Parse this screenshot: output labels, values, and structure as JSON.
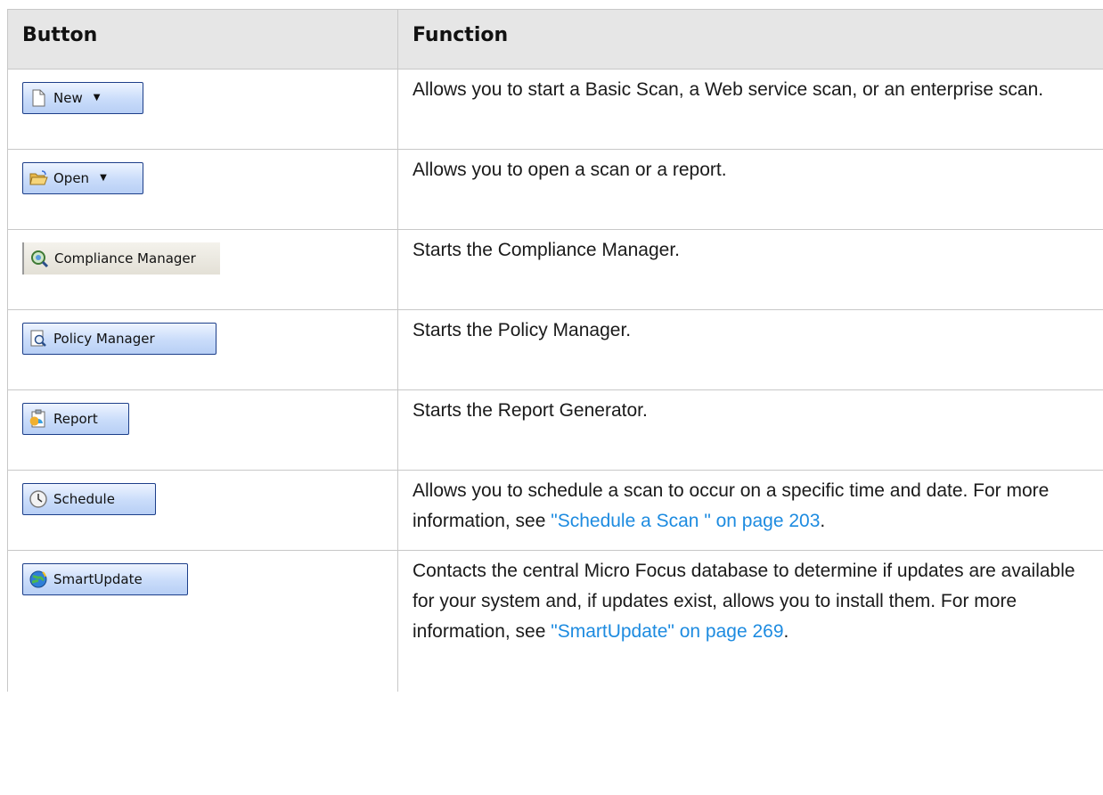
{
  "header": {
    "button_col": "Button",
    "function_col": "Function"
  },
  "rows": [
    {
      "button_label": "New",
      "has_dropdown": true,
      "icon": "document-icon",
      "function_text": "Allows you to start a Basic Scan, a Web service scan, or an enterprise scan."
    },
    {
      "button_label": "Open",
      "has_dropdown": true,
      "icon": "folder-open-icon",
      "function_text": "Allows you to open a scan or a report."
    },
    {
      "button_label": "Compliance Manager",
      "has_dropdown": false,
      "icon": "compliance-magnifier-icon",
      "function_text": "Starts the Compliance Manager."
    },
    {
      "button_label": "Policy Manager",
      "has_dropdown": false,
      "icon": "policy-magnifier-icon",
      "function_text": "Starts the Policy Manager."
    },
    {
      "button_label": "Report",
      "has_dropdown": false,
      "icon": "report-clipboard-icon",
      "function_text": "Starts the Report Generator."
    },
    {
      "button_label": "Schedule",
      "has_dropdown": false,
      "icon": "clock-icon",
      "function_text": "Allows you to schedule a scan to occur on a specific time and date. For more information, see ",
      "link_text": "\"Schedule a Scan \" on page 203",
      "after_link": "."
    },
    {
      "button_label": "SmartUpdate",
      "has_dropdown": false,
      "icon": "globe-update-icon",
      "function_text": "Contacts the central Micro Focus database to determine if updates are available for your system and, if updates exist, allows you to install them. For more information, see ",
      "link_text": "\"SmartUpdate\" on page 269",
      "after_link": "."
    }
  ]
}
